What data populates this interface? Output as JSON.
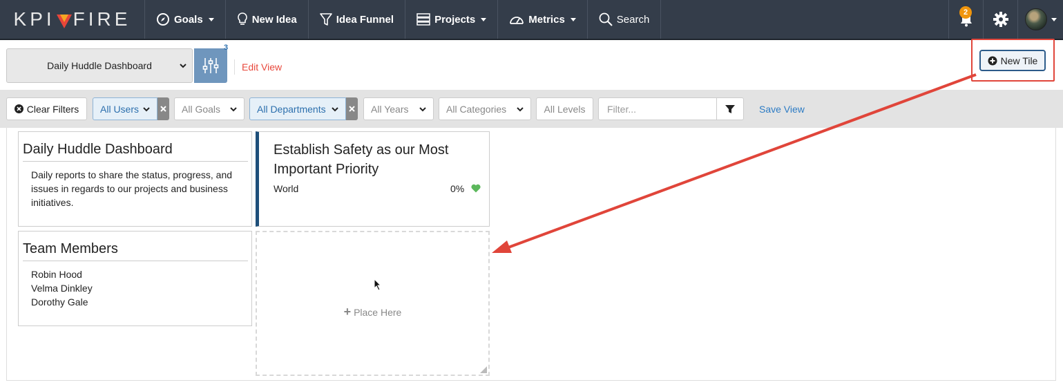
{
  "app": {
    "logo_left": "KPI",
    "logo_right": "FIRE"
  },
  "nav": {
    "goals": "Goals",
    "new_idea": "New Idea",
    "idea_funnel": "Idea Funnel",
    "projects": "Projects",
    "metrics": "Metrics",
    "search": "Search",
    "notification_count": "2"
  },
  "view": {
    "selected": "Daily Huddle Dashboard",
    "filter_count": "3",
    "edit_view": "Edit View",
    "new_tile": "New Tile"
  },
  "filters": {
    "clear": "Clear Filters",
    "users": "All Users",
    "goals": "All Goals",
    "departments": "All Departments",
    "years": "All Years",
    "categories": "All Categories",
    "levels": "All Levels",
    "filter_placeholder": "Filter...",
    "save_view": "Save View"
  },
  "tiles": {
    "dashboard": {
      "title": "Daily Huddle Dashboard",
      "description": "Daily reports to share the status, progress, and issues in regards to our projects and business initiatives."
    },
    "goal": {
      "title": "Establish Safety as our Most Important Priority",
      "scope": "World",
      "percent": "0%",
      "status_color": "#5cb85c"
    },
    "team": {
      "title": "Team Members",
      "members": [
        "Robin Hood",
        "Velma Dinkley",
        "Dorothy Gale"
      ]
    },
    "placeholder": {
      "label": "Place Here"
    }
  },
  "colors": {
    "navbar": "#343d4a",
    "accent_red": "#e0453a",
    "link_blue": "#2c7bc4"
  }
}
